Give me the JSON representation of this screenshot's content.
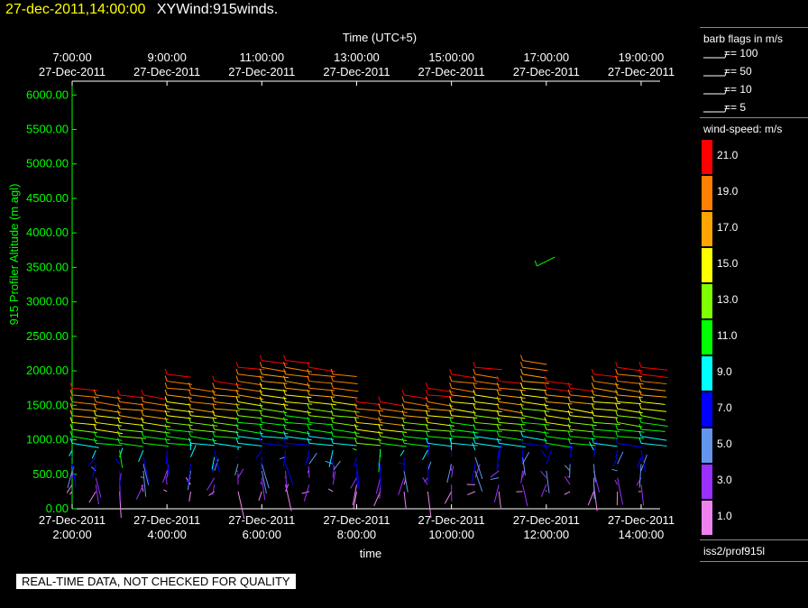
{
  "title": {
    "time": "27-dec-2011,14:00:00",
    "name": "XYWind:915winds."
  },
  "disclaimer": "REAL-TIME DATA, NOT CHECKED FOR QUALITY",
  "legend": {
    "barb_title": "barb flags in m/s",
    "barbs": [
      {
        "label": "== 100",
        "value": 100
      },
      {
        "label": "== 50",
        "value": 50
      },
      {
        "label": "== 10",
        "value": 10
      },
      {
        "label": "== 5",
        "value": 5
      }
    ],
    "speed_title": "wind-speed: m/s",
    "colors": [
      {
        "label": "21.0",
        "color": "#ff0000"
      },
      {
        "label": "19.0",
        "color": "#ff7f00"
      },
      {
        "label": "17.0",
        "color": "#ffa500"
      },
      {
        "label": "15.0",
        "color": "#ffff00"
      },
      {
        "label": "13.0",
        "color": "#80ff00"
      },
      {
        "label": "11.0",
        "color": "#00ff00"
      },
      {
        "label": "9.0",
        "color": "#00ffff"
      },
      {
        "label": "7.0",
        "color": "#0000ff"
      },
      {
        "label": "5.0",
        "color": "#6495ed"
      },
      {
        "label": "3.0",
        "color": "#9b30ff"
      },
      {
        "label": "1.0",
        "color": "#ee82ee"
      }
    ],
    "source": "iss2/prof915l"
  },
  "chart_data": {
    "type": "scatter",
    "ylabel": "915 Profiler Altitude (m agl)",
    "xlabel": "time",
    "top_axis_label": "Time (UTC+5)",
    "ylim": [
      0,
      6200
    ],
    "y_ticks": [
      "0.00",
      "500.00",
      "1000.00",
      "1500.00",
      "2000.00",
      "2500.00",
      "3000.00",
      "3500.00",
      "4000.00",
      "4500.00",
      "5000.00",
      "5500.00",
      "6000.00"
    ],
    "y_tick_values": [
      0,
      500,
      1000,
      1500,
      2000,
      2500,
      3000,
      3500,
      4000,
      4500,
      5000,
      5500,
      6000
    ],
    "bottom_ticks": [
      {
        "date": "27-Dec-2011",
        "time": "2:00:00",
        "hour": 2
      },
      {
        "date": "27-Dec-2011",
        "time": "4:00:00",
        "hour": 4
      },
      {
        "date": "27-Dec-2011",
        "time": "6:00:00",
        "hour": 6
      },
      {
        "date": "27-Dec-2011",
        "time": "8:00:00",
        "hour": 8
      },
      {
        "date": "27-Dec-2011",
        "time": "10:00:00",
        "hour": 10
      },
      {
        "date": "27-Dec-2011",
        "time": "12:00:00",
        "hour": 12
      },
      {
        "date": "27-Dec-2011",
        "time": "14:00:00",
        "hour": 14
      }
    ],
    "top_ticks": [
      {
        "time": "7:00:00",
        "date": "27-Dec-2011",
        "hour": 2
      },
      {
        "time": "9:00:00",
        "date": "27-Dec-2011",
        "hour": 4
      },
      {
        "time": "11:00:00",
        "date": "27-Dec-2011",
        "hour": 6
      },
      {
        "time": "13:00:00",
        "date": "27-Dec-2011",
        "hour": 8
      },
      {
        "time": "15:00:00",
        "date": "27-Dec-2011",
        "hour": 10
      },
      {
        "time": "17:00:00",
        "date": "27-Dec-2011",
        "hour": 12
      },
      {
        "time": "19:00:00",
        "date": "27-Dec-2011",
        "hour": 14
      }
    ],
    "xlim_hours": [
      2,
      14.4
    ],
    "profile_times_hours": [
      2.0,
      2.5,
      3.0,
      3.5,
      4.0,
      4.5,
      5.0,
      5.5,
      6.0,
      6.5,
      7.0,
      7.5,
      8.0,
      8.5,
      9.0,
      9.5,
      10.0,
      10.5,
      11.0,
      11.5,
      12.0,
      12.5,
      13.0,
      13.5,
      14.0
    ],
    "profile_tops_m": [
      1750,
      1700,
      1650,
      1700,
      1980,
      1800,
      1850,
      2050,
      2150,
      2150,
      2100,
      2000,
      1600,
      1550,
      1700,
      1750,
      2000,
      2050,
      1900,
      2200,
      1850,
      1800,
      2000,
      2050,
      2050
    ],
    "gate_spacing_m": 100,
    "lowest_gate_m": 250,
    "outlier": {
      "hour": 11.8,
      "altitude_m": [
        3520,
        3650
      ]
    }
  }
}
